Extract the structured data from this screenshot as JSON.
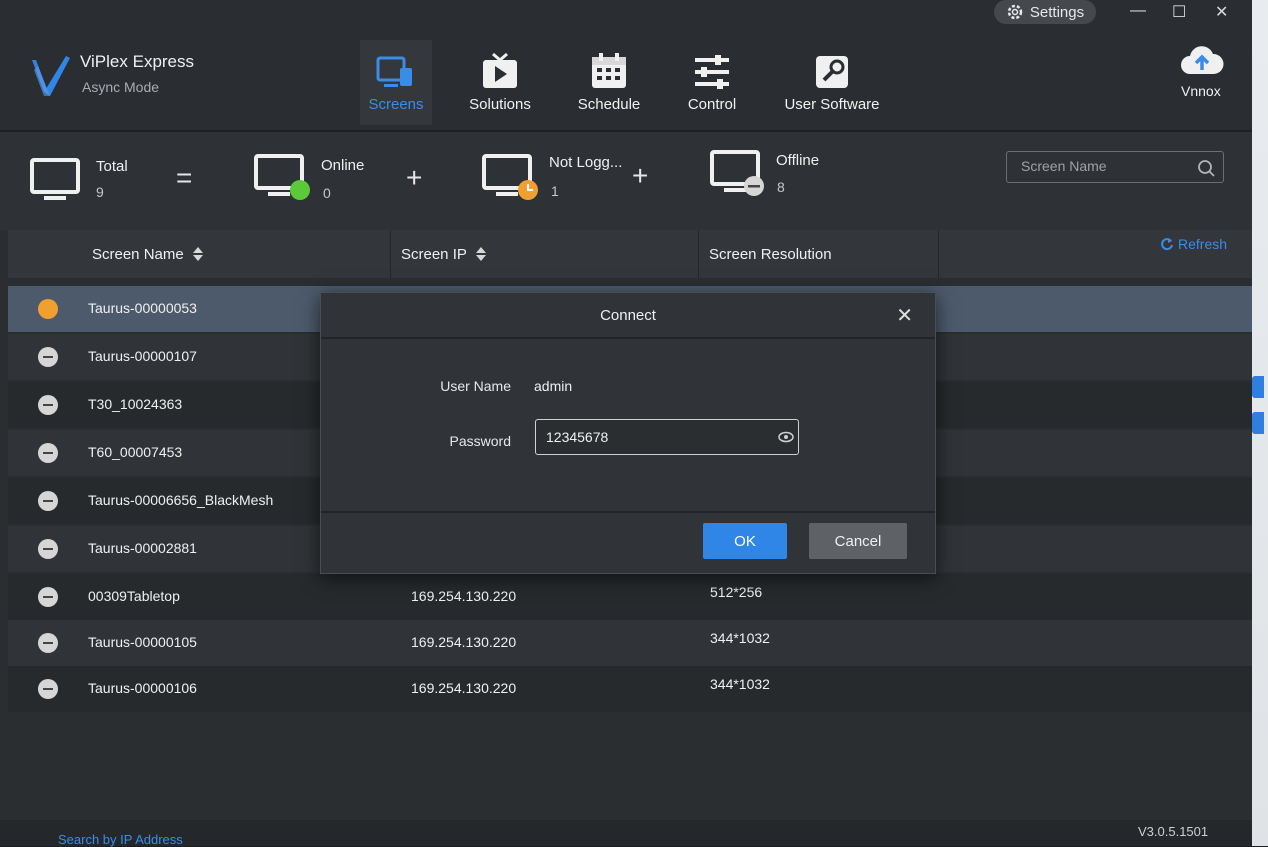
{
  "app": {
    "title": "ViPlex Express",
    "subtitle": "Async Mode"
  },
  "window": {
    "settings_label": "Settings",
    "minimize": "—",
    "maximize": "☐",
    "close": "✕"
  },
  "nav": [
    {
      "label": "Screens",
      "icon": "screens-icon",
      "active": true
    },
    {
      "label": "Solutions",
      "icon": "solutions-icon",
      "active": false
    },
    {
      "label": "Schedule",
      "icon": "schedule-icon",
      "active": false
    },
    {
      "label": "Control",
      "icon": "control-icon",
      "active": false
    },
    {
      "label": "User Software",
      "icon": "user-software-icon",
      "active": false
    }
  ],
  "account": {
    "label": "Vnnox"
  },
  "stats": {
    "total": {
      "label": "Total",
      "value": "9"
    },
    "online": {
      "label": "Online",
      "value": "0"
    },
    "not_logged": {
      "label": "Not Logg...",
      "value": "1"
    },
    "offline": {
      "label": "Offline",
      "value": "8"
    },
    "eq": "=",
    "plus": "+"
  },
  "search": {
    "placeholder": "Screen Name"
  },
  "table": {
    "columns": [
      "Screen Name",
      "Screen IP",
      "Screen Resolution"
    ],
    "refresh": "Refresh",
    "rows": [
      {
        "name": "Taurus-00000053",
        "ip": "",
        "res": "",
        "status": "not-logged"
      },
      {
        "name": "Taurus-00000107",
        "ip": "",
        "res": "",
        "status": "offline"
      },
      {
        "name": "T30_10024363",
        "ip": "",
        "res": "",
        "status": "offline"
      },
      {
        "name": "T60_00007453",
        "ip": "",
        "res": "",
        "status": "offline"
      },
      {
        "name": "Taurus-00006656_BlackMesh",
        "ip": "",
        "res": "",
        "status": "offline"
      },
      {
        "name": "Taurus-00002881",
        "ip": "",
        "res": "",
        "status": "offline"
      },
      {
        "name": "00309Tabletop",
        "ip": "169.254.130.220",
        "res": "512*256",
        "status": "offline"
      },
      {
        "name": "Taurus-00000105",
        "ip": "169.254.130.220",
        "res": "344*1032",
        "status": "offline"
      },
      {
        "name": "Taurus-00000106",
        "ip": "169.254.130.220",
        "res": "344*1032",
        "status": "offline"
      }
    ]
  },
  "footer": {
    "search_by_ip": "Search by IP Address",
    "version": "V3.0.5.1501"
  },
  "dialog": {
    "title": "Connect",
    "close": "✕",
    "username_label": "User Name",
    "username_value": "admin",
    "password_label": "Password",
    "password_value": "12345678",
    "ok": "OK",
    "cancel": "Cancel"
  },
  "colors": {
    "accent": "#2f86e6",
    "online": "#5cc93a",
    "not_logged": "#f0a030",
    "offline": "#d6d6d6"
  }
}
